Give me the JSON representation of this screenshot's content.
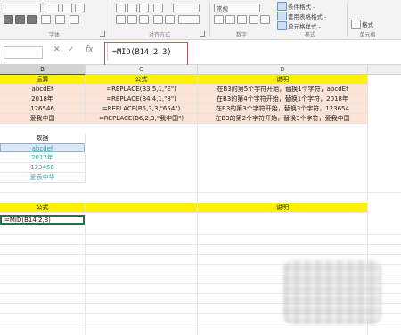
{
  "ribbon": {
    "groups": [
      "字体",
      "对齐方式",
      "数字",
      "样式",
      "单元格"
    ],
    "style_items": [
      "条件格式 -",
      "套用表格格式 -",
      "单元格样式 -"
    ],
    "cell_items": [
      "格式"
    ],
    "number_format": "常规"
  },
  "formula_bar": {
    "cancel_icon": "✕",
    "enter_icon": "✓",
    "fx_label": "fx",
    "formula": "=MID(B14,2,3)"
  },
  "columns": [
    "B",
    "C",
    "D"
  ],
  "table1": {
    "headers": [
      "运算",
      "公式",
      "说明"
    ],
    "rows": [
      [
        "abcdEf",
        "=REPLACE(B3,5,1,\"E\")",
        "在B3的第5个字符开始，替换1个字符，abcdEf"
      ],
      [
        "2018年",
        "=REPLACE(B4,4,1,\"8\")",
        "在B3的第4个字符开始，替换1个字符，2018年"
      ],
      [
        "126546",
        "=REPLACE(B5,3,3,\"654\")",
        "在B3的第3个字符开始，替换3个字符，123654"
      ],
      [
        "爱我中国",
        "=REPLACE(B6,2,3,\"我中国\")",
        "在B3的第2个字符开始，替换3个字符，爱我中国"
      ]
    ]
  },
  "data_block": {
    "header": "数据",
    "values": [
      "abcdef",
      "2017年",
      "123456",
      "爱表中华"
    ]
  },
  "table2": {
    "headers": [
      "公式",
      "",
      "说明"
    ],
    "active_cell": "=MID(B14,2,3)"
  }
}
